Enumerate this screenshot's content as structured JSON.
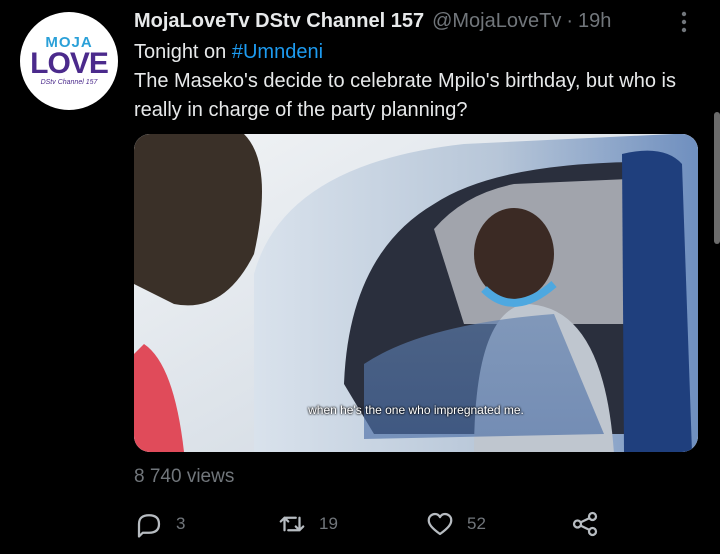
{
  "tweet": {
    "display_name": "MojaLoveTv DStv Channel 157",
    "handle": "@MojaLoveTv",
    "separator": "·",
    "time": "19h",
    "text_prefix": "Tonight on ",
    "hashtag": "#Umndeni",
    "text_body": "The Maseko's decide to celebrate Mpilo's birthday, but who is really in charge of the party planning?",
    "video_subtitle": "when he's the one who impregnated me.",
    "views": "8 740 views"
  },
  "avatar": {
    "logo_top": "MOJA",
    "logo_main": "LOVE",
    "logo_sub": "DStv Channel 157"
  },
  "actions": {
    "replies": "3",
    "retweets": "19",
    "likes": "52"
  },
  "icons": [
    "more-icon",
    "reply-icon",
    "retweet-icon",
    "like-icon",
    "share-icon"
  ],
  "colors": {
    "background": "#000000",
    "link": "#1d9bf0",
    "muted": "#71767b",
    "text": "#e7e9ea"
  }
}
